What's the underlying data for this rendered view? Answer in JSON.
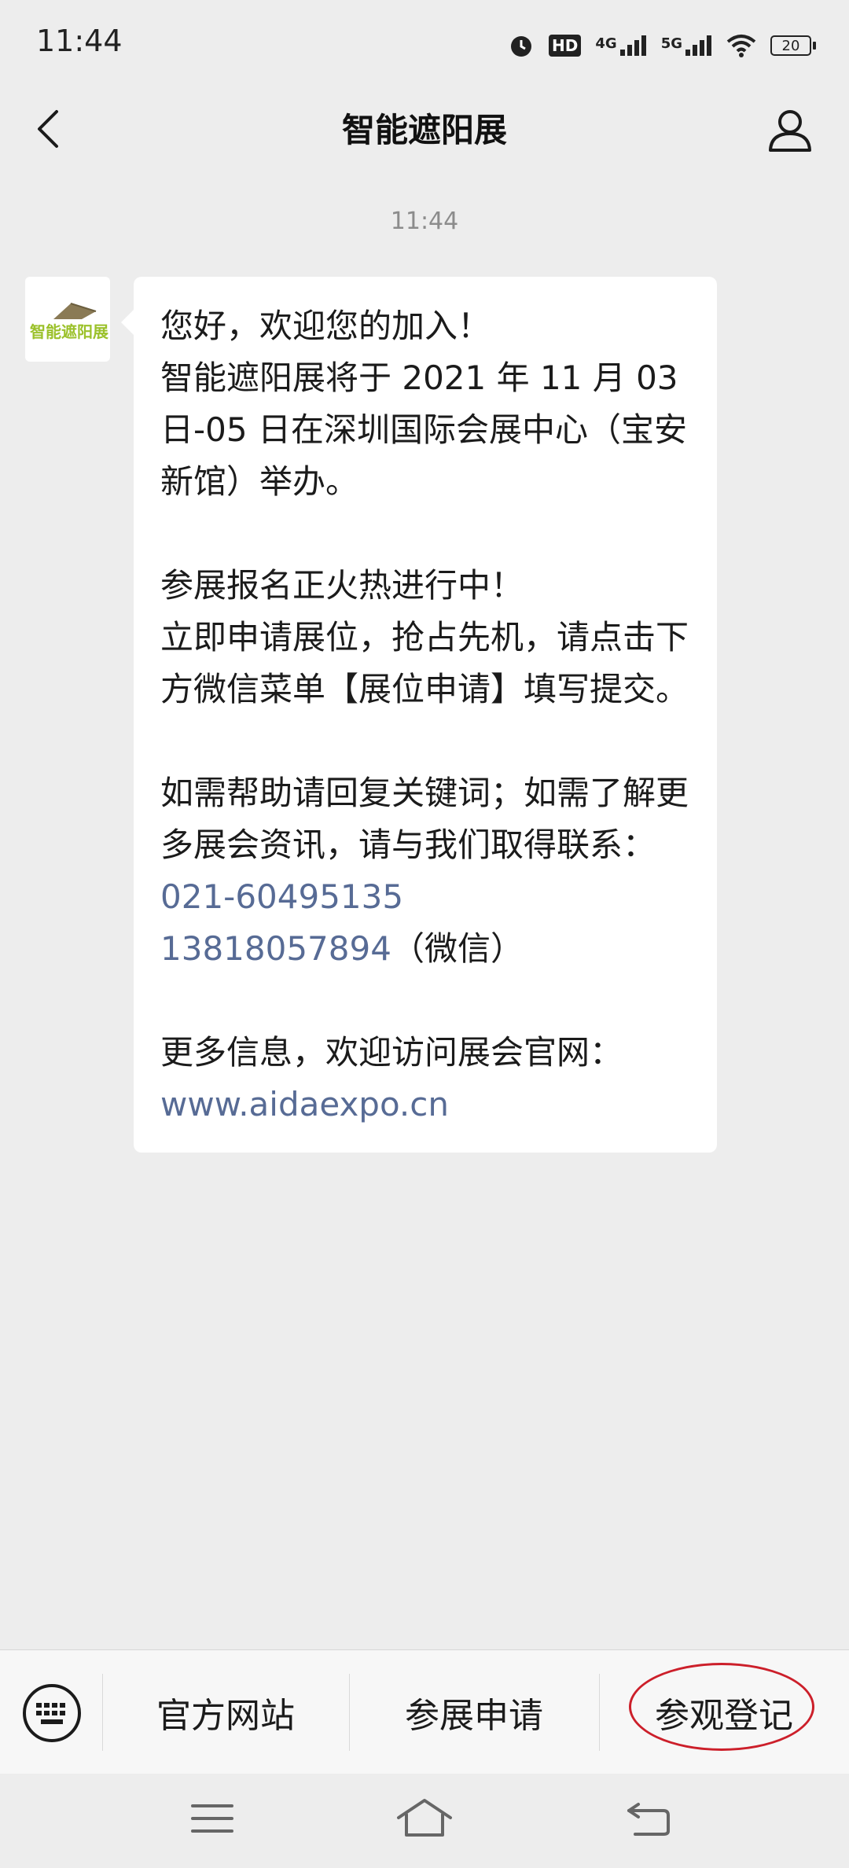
{
  "status_bar": {
    "time": "11:44",
    "hd_label": "HD",
    "signal_1_label": "4G",
    "signal_2_label": "5G",
    "battery": "20",
    "icons": [
      "alarm-icon",
      "hd-icon",
      "signal-4g-icon",
      "signal-5g-icon",
      "wifi-icon",
      "battery-icon"
    ]
  },
  "nav": {
    "title": "智能遮阳展",
    "icons": [
      "back-arrow-icon",
      "profile-icon"
    ]
  },
  "chat": {
    "timestamp": "11:44",
    "avatar_text": "智能遮阳展",
    "message": {
      "p1_line1": "您好，欢迎您的加入！",
      "p1_line2": "智能遮阳展将于 2021 年 11 月 03 日-05 日在深圳国际会展中心（宝安新馆）举办。",
      "p2_line1": "参展报名正火热进行中！",
      "p2_line2": "立即申请展位，抢占先机，请点击下方微信菜单【展位申请】填写提交。",
      "p3_text": "如需帮助请回复关键词；如需了解更多展会资讯，请与我们取得联系：",
      "phone": "021-60495135",
      "wechat_number": "13818057894",
      "wechat_suffix": "（微信）",
      "p4_text": "更多信息，欢迎访问展会官网：",
      "website": "www.aidaexpo.cn"
    }
  },
  "menu": {
    "items": [
      {
        "label": "官方网站"
      },
      {
        "label": "参展申请"
      },
      {
        "label": "参观登记"
      }
    ],
    "icons": [
      "keyboard-icon"
    ],
    "highlight_color": "#cc1f2a"
  },
  "system_nav": {
    "icons": [
      "menu-lines-icon",
      "home-icon",
      "back-return-icon"
    ]
  },
  "colors": {
    "background": "#EDEDED",
    "link": "#576b95",
    "bubble": "#ffffff",
    "logo_green": "#9bc12a",
    "logo_roof": "#8a7a55"
  }
}
